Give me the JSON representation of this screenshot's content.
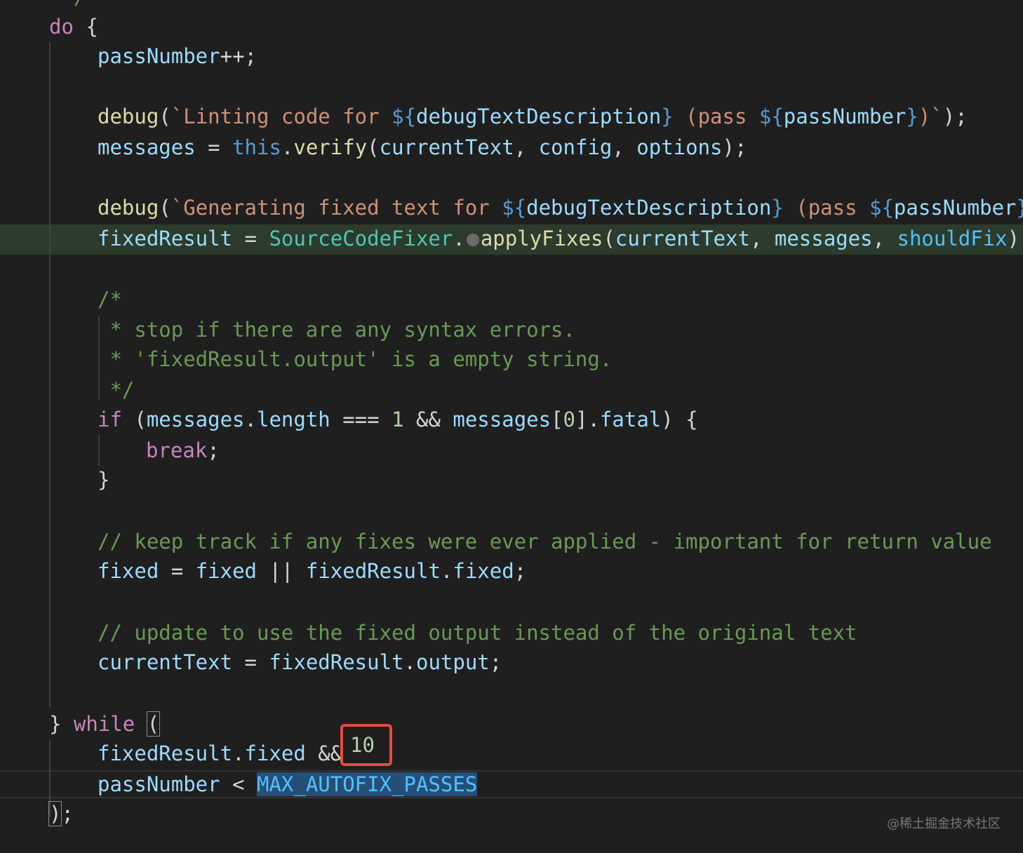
{
  "editor": {
    "lines": {
      "comment_end_top": " */",
      "do_open": "do {",
      "pass_increment_var": "passNumber",
      "pass_increment_op": "++;",
      "debug1": {
        "fn": "debug",
        "open": "(",
        "str1": "`Linting code for ",
        "tpl_open": "${",
        "var1": "debugTextDescription",
        "tpl_close": "}",
        "str2": " (pass ",
        "tpl_open2": "${",
        "var2": "passNumber",
        "tpl_close2": "}",
        "str3": ")`",
        "close": ");"
      },
      "verify": {
        "lhs": "messages",
        "eq": " = ",
        "this": "this",
        "dot": ".",
        "fn": "verify",
        "args_open": "(",
        "a1": "currentText",
        "sep1": ", ",
        "a2": "config",
        "sep2": ", ",
        "a3": "options",
        "close": ");"
      },
      "debug2": {
        "fn": "debug",
        "open": "(",
        "str1": "`Generating fixed text for ",
        "tpl_open": "${",
        "var1": "debugTextDescription",
        "tpl_close": "}",
        "str2": " (pass ",
        "tpl_open2": "${",
        "var2": "passNumber",
        "tpl_close2": "}"
      },
      "fixer": {
        "lhs": "fixedResult",
        "eq": " = ",
        "cls": "SourceCodeFixer",
        "dot": ".",
        "fn": "applyFixes",
        "open": "(",
        "a1": "currentText",
        "sep1": ", ",
        "a2": "messages",
        "sep2": ", ",
        "a3": "shouldFix",
        "close": ");"
      },
      "cmt_open": "/*",
      "cmt_l1": " * stop if there are any syntax errors.",
      "cmt_l2": " * 'fixedResult.output' is a empty string.",
      "cmt_close": " */",
      "if_stmt": {
        "kw": "if",
        "open": " (",
        "v1": "messages",
        "dot1": ".",
        "p1": "length",
        "op": " === ",
        "num": "1",
        "and": " && ",
        "v2": "messages",
        "idx_open": "[",
        "idx": "0",
        "idx_close": "].",
        "p2": "fatal",
        "close": ") {"
      },
      "break_kw": "break",
      "break_semi": ";",
      "if_close": "}",
      "cmt_keep": "// keep track if any fixes were ever applied - important for return value",
      "fixed_line": {
        "lhs": "fixed",
        "eq": " = ",
        "v1": "fixed",
        "or": " || ",
        "v2": "fixedResult",
        "dot": ".",
        "p": "fixed",
        "semi": ";"
      },
      "cmt_update": "// update to use the fixed output instead of the original text",
      "current_line": {
        "lhs": "currentText",
        "eq": " = ",
        "v": "fixedResult",
        "dot": ".",
        "p": "output",
        "semi": ";"
      },
      "while_line": {
        "brace": "} ",
        "kw": "while",
        "sp": " ",
        "paren": "("
      },
      "cond1": {
        "v": "fixedResult",
        "dot": ".",
        "p": "fixed",
        "and": " &&"
      },
      "cond2": {
        "v": "passNumber",
        "lt": " < ",
        "const": "MAX_AUTOFIX_PASSES"
      },
      "end_paren": ")",
      "end_semi": ";"
    },
    "inline_value": "10"
  },
  "watermark": "@稀土掘金技术社区"
}
